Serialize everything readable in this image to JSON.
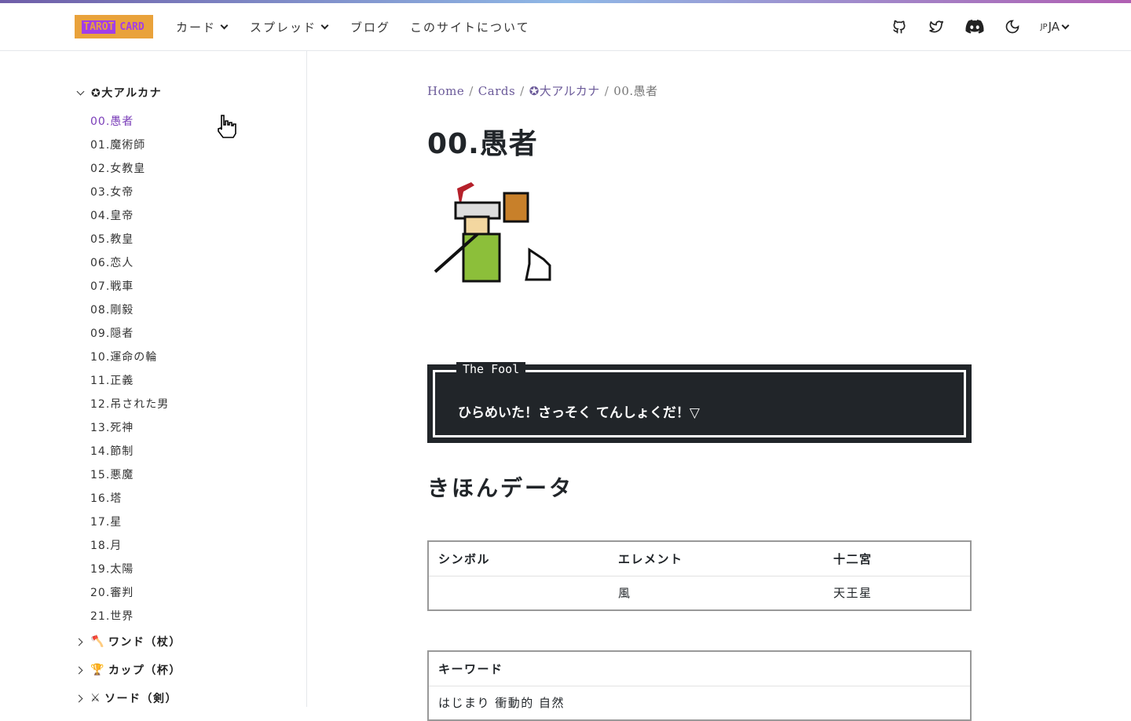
{
  "header": {
    "logo": [
      "TAROT",
      "CARD"
    ],
    "nav": [
      {
        "label": "カード",
        "dropdown": true
      },
      {
        "label": "スプレッド",
        "dropdown": true
      },
      {
        "label": "ブログ"
      },
      {
        "label": "このサイトについて"
      }
    ],
    "icons": [
      "github-icon",
      "twitter-icon",
      "discord-icon",
      "moon-icon"
    ],
    "lang_prefix": "JP",
    "lang": "JA"
  },
  "sidebar": {
    "major": {
      "label": "✪大アルカナ",
      "cards": [
        "00.愚者",
        "01.魔術師",
        "02.女教皇",
        "03.女帝",
        "04.皇帝",
        "05.教皇",
        "06.恋人",
        "07.戦車",
        "08.剛毅",
        "09.隠者",
        "10.運命の輪",
        "11.正義",
        "12.吊された男",
        "13.死神",
        "14.節制",
        "15.悪魔",
        "16.塔",
        "17.星",
        "18.月",
        "19.太陽",
        "20.審判",
        "21.世界"
      ]
    },
    "sections": [
      {
        "icon": "🪓",
        "label": "ワンド（杖）"
      },
      {
        "icon": "🏆",
        "label": "カップ（杯）"
      },
      {
        "icon": "⚔",
        "label": "ソード（剣）"
      }
    ]
  },
  "breadcrumb": [
    "Home",
    "Cards",
    "✪大アルカナ",
    "00.愚者"
  ],
  "page": {
    "title": "00.愚者",
    "dialog_title": "The Fool",
    "dialog_text": "ひらめいた！さっそく てんしょくだ！▽",
    "section_title": "きほんデータ",
    "basic": {
      "headers": [
        "シンボル",
        "エレメント",
        "十二宮"
      ],
      "row": [
        "",
        "風",
        "天王星"
      ]
    },
    "keywords": {
      "header": "キーワード",
      "value": "はじまり 衝動的 自然"
    }
  },
  "colors": {
    "accent": "#7a3db8",
    "dialog_bg": "#212529",
    "logo_bg": "#e9a23b"
  }
}
